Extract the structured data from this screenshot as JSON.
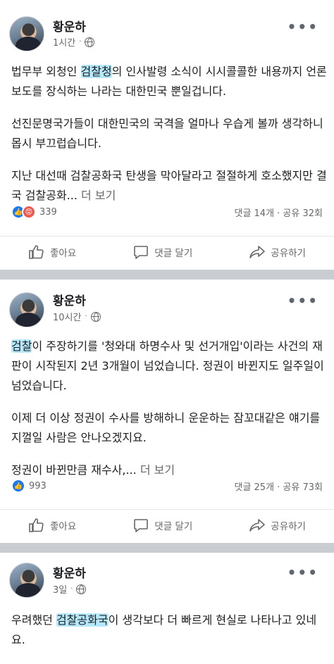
{
  "posts": [
    {
      "author": "황운하",
      "time": "1시간",
      "dot": "·",
      "paragraphs": [
        {
          "pre": "법무부 외청인 ",
          "hl": "검찰청",
          "post": "의 인사발령 소식이 시시콜콜한 내용까지 언론보도를 장식하는 나라는 대한민국 뿐일겁니다."
        },
        {
          "pre": "선진문명국가들이 대한민국의 국격을 얼마나 우습게 볼까 생각하니 몹시 부끄럽습니다.",
          "hl": "",
          "post": ""
        },
        {
          "pre": "지난 대선때 검찰공화국 탄생을 막아달라고 절절하게 호소했지만 결국 검찰공화...",
          "hl": "",
          "post": ""
        }
      ],
      "see_more": "더 보기",
      "reaction_count": "339",
      "comments_shares": "댓글 14개 · 공유 32회",
      "has_angry": true
    },
    {
      "author": "황운하",
      "time": "10시간",
      "dot": "·",
      "paragraphs": [
        {
          "pre": "",
          "hl": "검찰",
          "post": "이 주장하기를 '청와대 하명수사 및 선거개입'이라는 사건의 재판이 시작된지 2년 3개월이 넘었습니다. 정권이 바뀐지도 일주일이 넘었습니다."
        },
        {
          "pre": "이제 더 이상 정권이 수사를 방해하니 운운하는 잠꼬대같은 얘기를 지껄일 사람은 안나오겠지요.",
          "hl": "",
          "post": ""
        },
        {
          "pre": "정권이 바뀐만큼 재수사,...",
          "hl": "",
          "post": ""
        }
      ],
      "see_more": "더 보기",
      "reaction_count": "993",
      "comments_shares": "댓글 25개 · 공유 73회",
      "has_angry": false
    },
    {
      "author": "황운하",
      "time": "3일",
      "dot": "·",
      "paragraphs": [
        {
          "pre": "우려했던 ",
          "hl": "검찰공화국",
          "post": "이 생각보다 더 빠르게 현실로 나타나고 있네요."
        }
      ]
    }
  ],
  "actions": {
    "like": "좋아요",
    "comment": "댓글 달기",
    "share": "공유하기"
  },
  "colors": {
    "highlight": "#77d6f5",
    "like_blue": "#1877f2",
    "angry": "#f0584f"
  }
}
